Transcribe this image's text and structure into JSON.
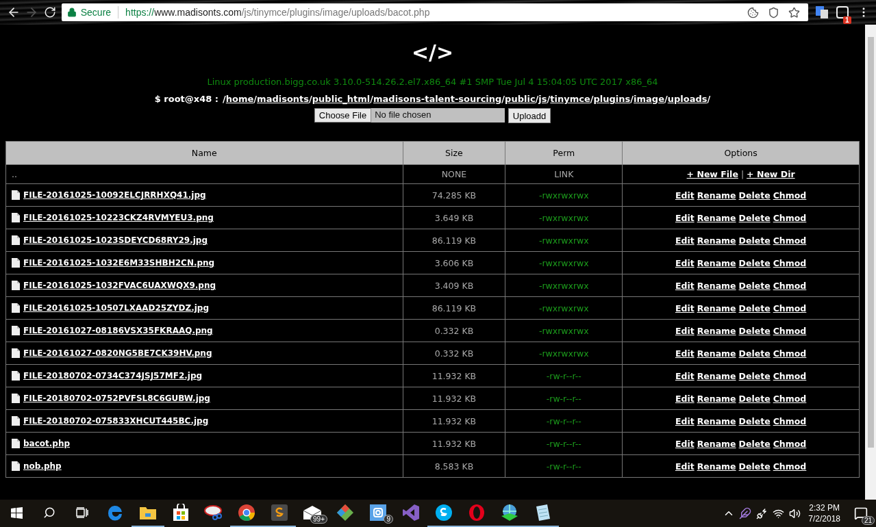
{
  "browser": {
    "forward_disabled": true,
    "security_label": "Secure",
    "url": {
      "scheme": "https://",
      "host": "www.madisonts.com",
      "path": "/js/tinymce/plugins/image/uploads/bacot.php"
    },
    "extension_badge": "1"
  },
  "page": {
    "logo": "</>",
    "uname": "Linux production.bigg.co.uk 3.10.0-514.26.2.el7.x86_64 #1 SMP Tue Jul 4 15:04:05 UTC 2017 x86_64",
    "prompt": "$ root@x48 :",
    "path_root": "/",
    "path": [
      {
        "link": "home",
        "sep": "/"
      },
      {
        "link": "madisonts",
        "sep": "/"
      },
      {
        "link": "public_html",
        "sep": "/"
      },
      {
        "link": "madisons-talent-sourcing",
        "sep": "/"
      },
      {
        "link": "public",
        "sep": "/"
      },
      {
        "link": "js",
        "sep": "/"
      },
      {
        "link": "tinymce",
        "sep": "/"
      },
      {
        "link": "plugins",
        "sep": "/"
      },
      {
        "link": "image",
        "sep": "/"
      },
      {
        "link": "uploads",
        "sep": "/"
      }
    ],
    "file_button": "Choose File",
    "file_status": "No file chosen",
    "upload_button": "Uploadd"
  },
  "table": {
    "columns": [
      "Name",
      "Size",
      "Perm",
      "Options"
    ],
    "parent": {
      "name": "..",
      "size": "NONE",
      "perm": "LINK",
      "actions": [
        "+ New File",
        "+ New Dir"
      ],
      "separator": "|"
    },
    "rows": [
      {
        "name": "FILE-20161025-10092ELCJRRHXQ41.jpg",
        "size": "74.285 KB",
        "perm": "-rwxrwxrwx",
        "actions": [
          "Edit",
          "Rename",
          "Delete",
          "Chmod"
        ]
      },
      {
        "name": "FILE-20161025-10223CKZ4RVMYEU3.png",
        "size": "3.649 KB",
        "perm": "-rwxrwxrwx",
        "actions": [
          "Edit",
          "Rename",
          "Delete",
          "Chmod"
        ]
      },
      {
        "name": "FILE-20161025-1023SDEYCD68RY29.jpg",
        "size": "86.119 KB",
        "perm": "-rwxrwxrwx",
        "actions": [
          "Edit",
          "Rename",
          "Delete",
          "Chmod"
        ]
      },
      {
        "name": "FILE-20161025-1032E6M33SHBH2CN.png",
        "size": "3.606 KB",
        "perm": "-rwxrwxrwx",
        "actions": [
          "Edit",
          "Rename",
          "Delete",
          "Chmod"
        ]
      },
      {
        "name": "FILE-20161025-1032FVAC6UAXWQX9.png",
        "size": "3.409 KB",
        "perm": "-rwxrwxrwx",
        "actions": [
          "Edit",
          "Rename",
          "Delete",
          "Chmod"
        ]
      },
      {
        "name": "FILE-20161025-10507LXAAD25ZYDZ.jpg",
        "size": "86.119 KB",
        "perm": "-rwxrwxrwx",
        "actions": [
          "Edit",
          "Rename",
          "Delete",
          "Chmod"
        ]
      },
      {
        "name": "FILE-20161027-08186VSX35FKRAAQ.png",
        "size": "0.332 KB",
        "perm": "-rwxrwxrwx",
        "actions": [
          "Edit",
          "Rename",
          "Delete",
          "Chmod"
        ]
      },
      {
        "name": "FILE-20161027-0820NG5BE7CK39HV.png",
        "size": "0.332 KB",
        "perm": "-rwxrwxrwx",
        "actions": [
          "Edit",
          "Rename",
          "Delete",
          "Chmod"
        ]
      },
      {
        "name": "FILE-20180702-0734C374JSJ57MF2.jpg",
        "size": "11.932 KB",
        "perm": "-rw-r--r--",
        "actions": [
          "Edit",
          "Rename",
          "Delete",
          "Chmod"
        ]
      },
      {
        "name": "FILE-20180702-0752PVFSL8C6GUBW.jpg",
        "size": "11.932 KB",
        "perm": "-rw-r--r--",
        "actions": [
          "Edit",
          "Rename",
          "Delete",
          "Chmod"
        ]
      },
      {
        "name": "FILE-20180702-075833XHCUT445BC.jpg",
        "size": "11.932 KB",
        "perm": "-rw-r--r--",
        "actions": [
          "Edit",
          "Rename",
          "Delete",
          "Chmod"
        ]
      },
      {
        "name": "bacot.php",
        "size": "11.932 KB",
        "perm": "-rw-r--r--",
        "actions": [
          "Edit",
          "Rename",
          "Delete",
          "Chmod"
        ]
      },
      {
        "name": "nob.php",
        "size": "8.583 KB",
        "perm": "-rw-r--r--",
        "actions": [
          "Edit",
          "Rename",
          "Delete",
          "Chmod"
        ]
      }
    ]
  },
  "taskbar": {
    "apps": [
      {
        "running": false
      },
      {
        "running": true
      },
      {
        "running": false
      },
      {
        "running": false
      },
      {
        "running": true
      },
      {
        "running": true
      },
      {
        "running": false,
        "badge": "99+"
      },
      {
        "running": false
      },
      {
        "running": false,
        "badge": "9"
      },
      {
        "running": false
      },
      {
        "running": true
      },
      {
        "running": true
      },
      {
        "running": true
      },
      {
        "running": true
      }
    ],
    "time": "2:32 PM",
    "date": "7/2/2018",
    "notifications": "21"
  }
}
